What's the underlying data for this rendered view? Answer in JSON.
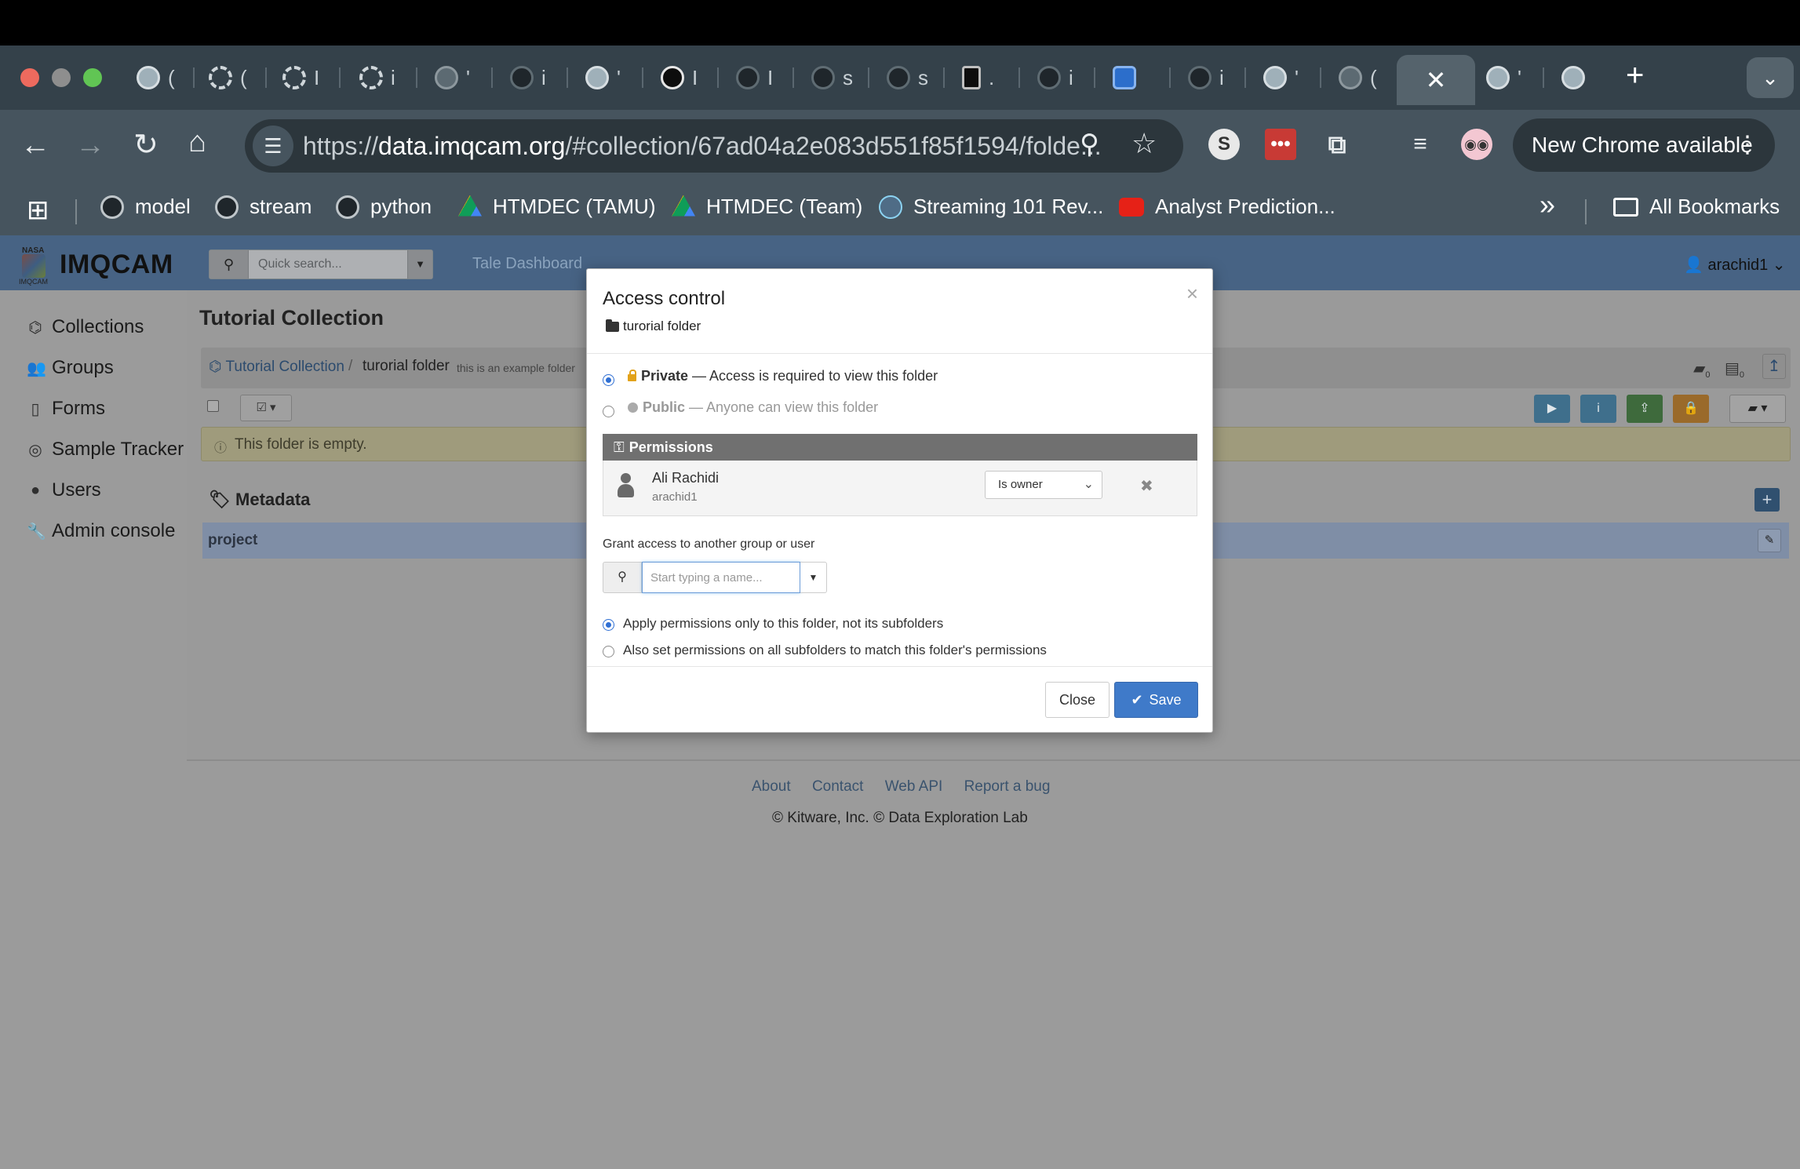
{
  "browser": {
    "active_tab_close": "✕",
    "new_tab": "+",
    "url_host": "data.imqcam.org",
    "url_scheme": "https://",
    "url_rest": "/#collection/67ad04a2e083d551f85f1594/folde...",
    "new_chrome_label": "New Chrome available",
    "bookmarks": [
      "model",
      "stream",
      "python",
      "HTMDEC (TAMU)",
      "HTMDEC (Team)",
      "Streaming 101 Rev...",
      "Analyst Prediction..."
    ],
    "all_bookmarks": "All Bookmarks",
    "overflow": "»"
  },
  "app": {
    "logo": "IMQCAM",
    "logo_small_top": "NASA",
    "logo_small_bottom": "IMQCAM",
    "search_placeholder": "Quick search...",
    "nav_link": "Tale Dashboard",
    "user": "arachid1"
  },
  "sidebar": {
    "items": [
      {
        "label": "Collections",
        "icon": "sitemap-icon"
      },
      {
        "label": "Groups",
        "icon": "users-icon"
      },
      {
        "label": "Forms",
        "icon": "document-icon"
      },
      {
        "label": "Sample Tracker",
        "icon": "compass-icon"
      },
      {
        "label": "Users",
        "icon": "user-icon"
      },
      {
        "label": "Admin console",
        "icon": "wrench-icon"
      }
    ]
  },
  "main": {
    "title": "Tutorial Collection",
    "breadcrumb_root": "Tutorial Collection",
    "breadcrumb_sep": "/",
    "breadcrumb_current": "turorial folder",
    "breadcrumb_desc": "this is an example folder",
    "folder_count": "0",
    "item_count": "0",
    "empty_message": "This folder is empty.",
    "metadata_title": "Metadata",
    "metadata_key": "project"
  },
  "footer": {
    "links": [
      "About",
      "Contact",
      "Web API",
      "Report a bug"
    ],
    "copyright": "© Kitware, Inc. © Data Exploration Lab"
  },
  "modal": {
    "title": "Access control",
    "subtitle": "turorial folder",
    "close_x": "×",
    "private_label": "Private",
    "private_desc": " — Access is required to view this folder",
    "public_label": "Public",
    "public_desc": " — Anyone can view this folder",
    "permissions_title": "Permissions",
    "perm_user_name": "Ali Rachidi",
    "perm_user_login": "arachid1",
    "perm_level": "Is owner",
    "remove_icon": "✖",
    "grant_label": "Grant access to another group or user",
    "grant_placeholder": "Start typing a name...",
    "apply_only": "Apply permissions only to this folder, not its subfolders",
    "apply_recursive": "Also set permissions on all subfolders to match this folder's permissions",
    "close_button": "Close",
    "save_button": "Save"
  },
  "colors": {
    "header": "#476384",
    "save": "#3f7ac9",
    "permissions_header": "#707070"
  }
}
